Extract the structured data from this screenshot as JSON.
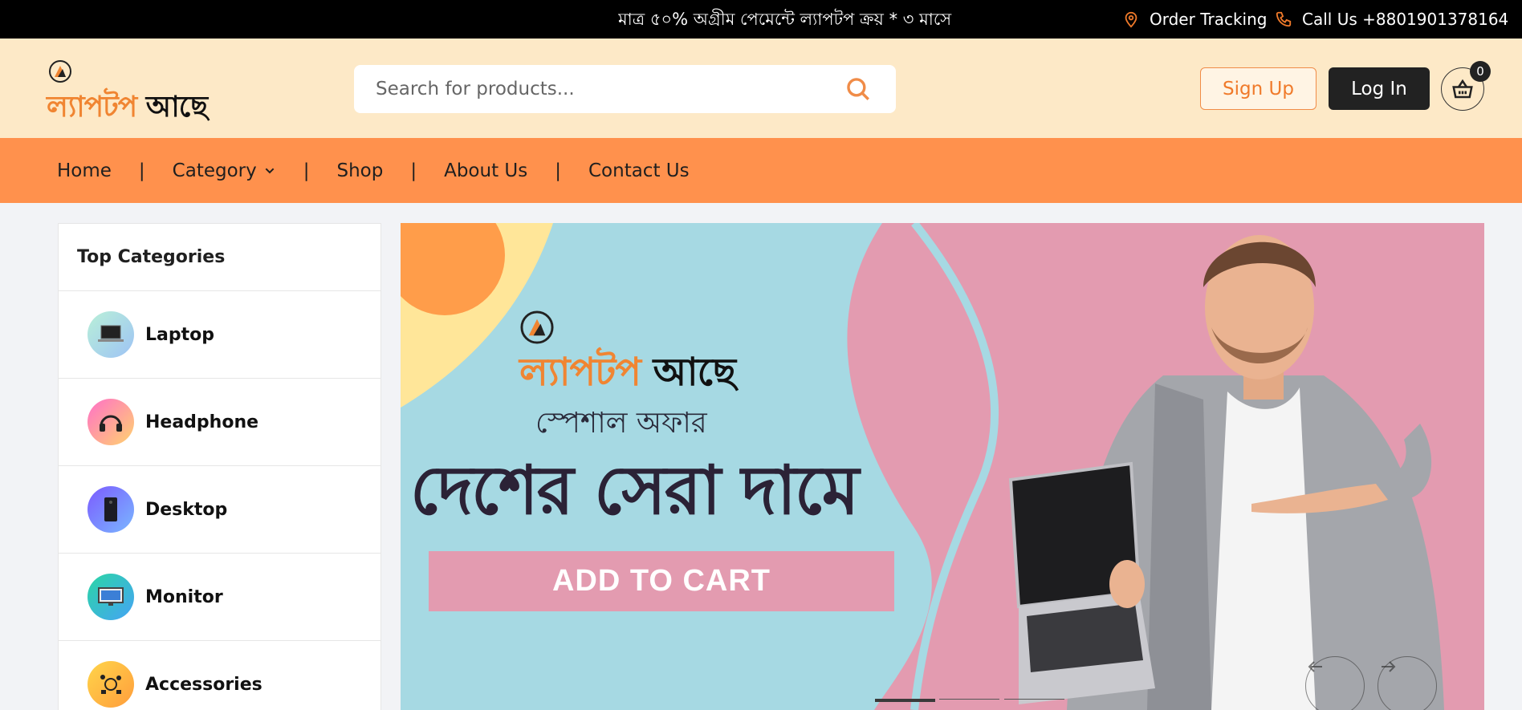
{
  "topbar": {
    "ticker": "মাত্র ৫০% অগ্রীম পেমেন্টে ল্যাপটপ ক্রয় * ৩ মাসে",
    "order_tracking": "Order Tracking",
    "call_us": "Call Us +8801901378164"
  },
  "header": {
    "logo_part1": "ল্যাপটপ",
    "logo_part2": "আছে",
    "search_placeholder": "Search for products...",
    "signup_label": "Sign Up",
    "login_label": "Log In",
    "cart_count": "0"
  },
  "nav": {
    "items": [
      {
        "label": "Home"
      },
      {
        "label": "Category"
      },
      {
        "label": "Shop"
      },
      {
        "label": "About Us"
      },
      {
        "label": "Contact Us"
      }
    ],
    "separator": "|"
  },
  "sidebar": {
    "title": "Top Categories",
    "items": [
      {
        "label": "Laptop",
        "icon": "laptop-icon"
      },
      {
        "label": "Headphone",
        "icon": "headphone-icon"
      },
      {
        "label": "Desktop",
        "icon": "desktop-icon"
      },
      {
        "label": "Monitor",
        "icon": "monitor-icon"
      },
      {
        "label": "Accessories",
        "icon": "accessories-icon"
      }
    ]
  },
  "hero": {
    "logo_part1": "ল্যাপটপ",
    "logo_part2": "আছে",
    "subtitle": "স্পেশাল অফার",
    "headline": "দেশের সেরা দামে",
    "cta": "ADD TO CART"
  },
  "colors": {
    "accent_orange": "#ff914d",
    "header_bg": "#fde9c7",
    "hero_blue": "#a6d9e3",
    "hero_pink": "#e39bb0"
  }
}
